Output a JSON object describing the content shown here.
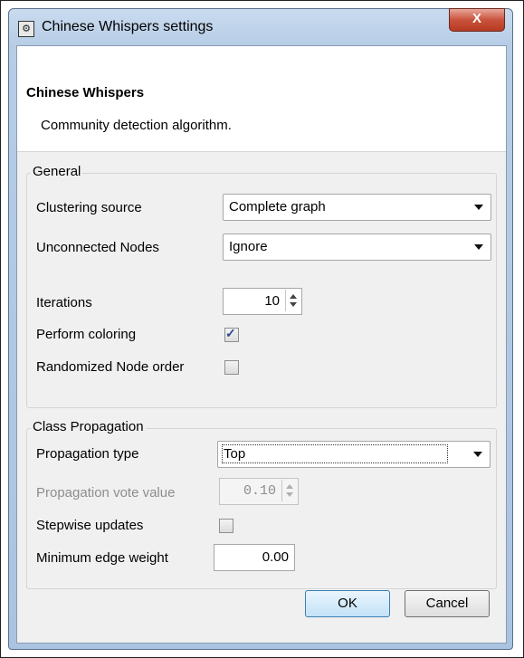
{
  "window": {
    "title": "Chinese Whispers settings",
    "close_glyph": "X"
  },
  "header": {
    "title": "Chinese Whispers",
    "subtitle": "Community detection algorithm."
  },
  "general": {
    "legend": "General",
    "clustering_source": {
      "label": "Clustering source",
      "value": "Complete graph"
    },
    "unconnected_nodes": {
      "label": "Unconnected Nodes",
      "value": "Ignore"
    },
    "iterations": {
      "label": "Iterations",
      "value": "10"
    },
    "perform_coloring": {
      "label": "Perform coloring",
      "checked": true
    },
    "randomized_node_order": {
      "label": "Randomized Node order",
      "checked": false
    }
  },
  "class_propagation": {
    "legend": "Class Propagation",
    "propagation_type": {
      "label": "Propagation type",
      "value": "Top"
    },
    "propagation_vote_value": {
      "label": "Propagation vote value",
      "value": "0.10",
      "enabled": false
    },
    "stepwise_updates": {
      "label": "Stepwise updates",
      "checked": false
    },
    "minimum_edge_weight": {
      "label": "Minimum edge weight",
      "value": "0.00"
    }
  },
  "buttons": {
    "ok": "OK",
    "cancel": "Cancel"
  },
  "icons": {
    "app": "app-logo-icon",
    "close": "close-icon",
    "check": "checkmark-icon"
  },
  "colors": {
    "titlebar": "#b7cde6",
    "close": "#c9523c",
    "check": "#2a4a8c",
    "dialog_bg": "#f0f0f0"
  }
}
